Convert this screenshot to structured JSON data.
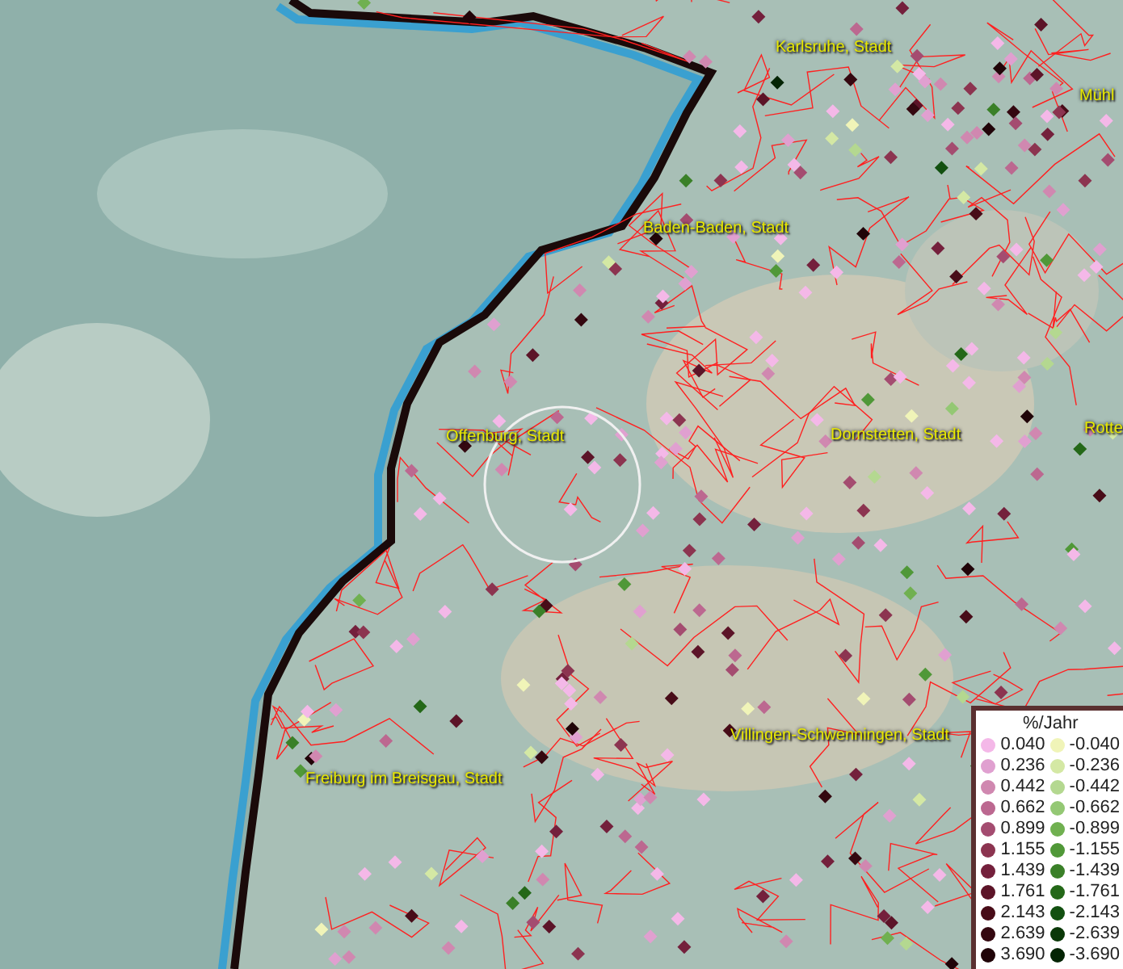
{
  "map": {
    "labels": [
      {
        "text": "Karlsruhe, Stadt"
      },
      {
        "text": "Mühl"
      },
      {
        "text": "Baden-Baden, Stadt"
      },
      {
        "text": "Offenburg, Stadt"
      },
      {
        "text": "Dornstetten, Stadt"
      },
      {
        "text": "Rotte"
      },
      {
        "text": "Villingen-Schwenningen, Stadt"
      },
      {
        "text": "Freiburg im Breisgau, Stadt"
      }
    ]
  },
  "legend": {
    "title": "%/Jahr",
    "positive": [
      {
        "value": "0.040",
        "color": "#f4b8e8"
      },
      {
        "value": "0.236",
        "color": "#e0a0d0"
      },
      {
        "value": "0.442",
        "color": "#d088b0"
      },
      {
        "value": "0.662",
        "color": "#bc6890"
      },
      {
        "value": "0.899",
        "color": "#a44c70"
      },
      {
        "value": "1.155",
        "color": "#8c3450"
      },
      {
        "value": "1.439",
        "color": "#74203c"
      },
      {
        "value": "1.761",
        "color": "#5c1428"
      },
      {
        "value": "2.143",
        "color": "#480c18"
      },
      {
        "value": "2.639",
        "color": "#340810"
      },
      {
        "value": "3.690",
        "color": "#200408"
      }
    ],
    "negative": [
      {
        "value": "-0.040",
        "color": "#f0f4b8"
      },
      {
        "value": "-0.236",
        "color": "#d4e8a4"
      },
      {
        "value": "-0.442",
        "color": "#b4d890"
      },
      {
        "value": "-0.662",
        "color": "#94c874"
      },
      {
        "value": "-0.899",
        "color": "#70b050"
      },
      {
        "value": "-1.155",
        "color": "#509838"
      },
      {
        "value": "-1.439",
        "color": "#3a8028"
      },
      {
        "value": "-1.761",
        "color": "#246818"
      },
      {
        "value": "-2.143",
        "color": "#125010"
      },
      {
        "value": "-2.639",
        "color": "#0a3808"
      },
      {
        "value": "-3.690",
        "color": "#042404"
      }
    ]
  }
}
